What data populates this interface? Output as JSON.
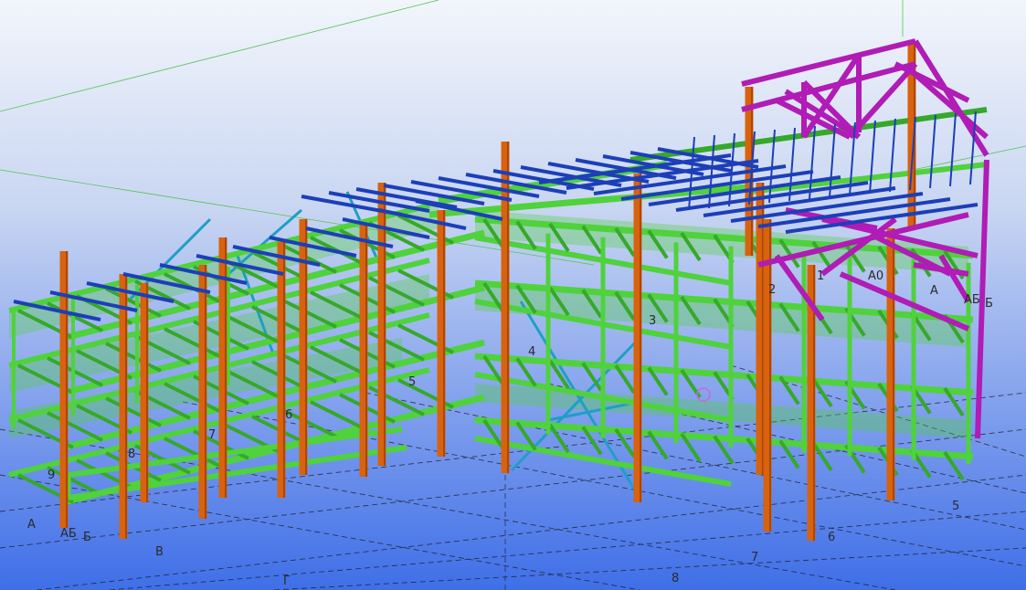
{
  "viewport": {
    "type": "3d-structural-model",
    "background_top": "#f2f5fb",
    "background_bottom": "#3f6fe8"
  },
  "colors": {
    "beam": "#4fd23c",
    "beam_dark": "#36a82a",
    "column": "#d8620e",
    "column_dark": "#a9470a",
    "purlin": "#1c3fb8",
    "bracing": "#1f9fc4",
    "truss": "#b01cb5",
    "grid_line": "#1a1a1a"
  },
  "grid_labels": {
    "front_row": [
      "9",
      "8",
      "7",
      "6",
      "5",
      "4",
      "3",
      "2",
      "1"
    ],
    "front_axes": [
      "А",
      "АБ",
      "Б",
      "В",
      "Г"
    ],
    "right_axes": [
      "А0",
      "А",
      "АБ",
      "Б"
    ],
    "bottom_numbers": [
      "5",
      "6",
      "7",
      "8"
    ]
  }
}
